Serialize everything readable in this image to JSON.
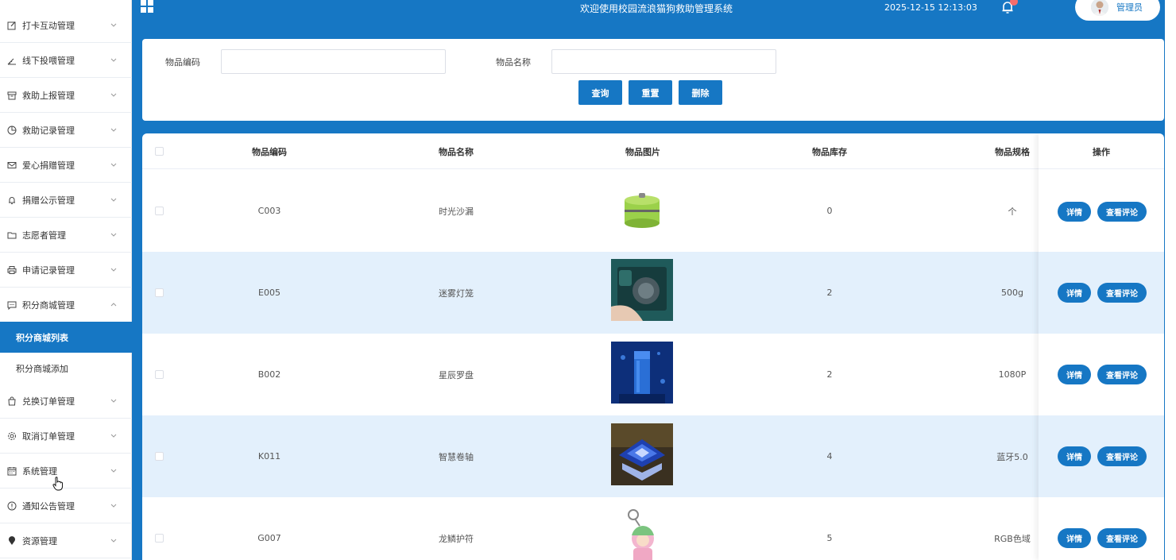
{
  "header": {
    "title": "欢迎使用校园流浪猫狗救助管理系统",
    "datetime": "2025-12-15 12:13:03",
    "notification_count": "",
    "user_name": "管理员"
  },
  "sidebar": {
    "items": [
      {
        "label": "打卡互动管理"
      },
      {
        "label": "线下投喂管理"
      },
      {
        "label": "救助上报管理"
      },
      {
        "label": "救助记录管理"
      },
      {
        "label": "爱心捐赠管理"
      },
      {
        "label": "捐赠公示管理"
      },
      {
        "label": "志愿者管理"
      },
      {
        "label": "申请记录管理"
      },
      {
        "label": "积分商城管理"
      },
      {
        "label": "兑换订单管理"
      },
      {
        "label": "取消订单管理"
      },
      {
        "label": "系统管理"
      },
      {
        "label": "通知公告管理"
      },
      {
        "label": "资源管理"
      }
    ],
    "sub_items": [
      {
        "label": "积分商城列表"
      },
      {
        "label": "积分商城添加"
      }
    ]
  },
  "search": {
    "code_label": "物品编码",
    "name_label": "物品名称",
    "code_value": "",
    "name_value": "",
    "query_label": "查询",
    "reset_label": "重置",
    "delete_label": "删除"
  },
  "table": {
    "headers": {
      "code": "物品编码",
      "name": "物品名称",
      "image": "物品图片",
      "stock": "物品库存",
      "spec": "物品规格",
      "ops": "操作"
    },
    "detail_label": "详情",
    "comments_label": "查看评论",
    "rows": [
      {
        "code": "C003",
        "name": "时光沙漏",
        "stock": "0",
        "spec": "个",
        "image": "lunchbox"
      },
      {
        "code": "E005",
        "name": "迷雾灯笼",
        "stock": "2",
        "spec": "500g",
        "image": "gadget"
      },
      {
        "code": "B002",
        "name": "星辰罗盘",
        "stock": "2",
        "spec": "1080P",
        "image": "bottle"
      },
      {
        "code": "K011",
        "name": "智慧卷轴",
        "stock": "4",
        "spec": "蓝牙5.0",
        "image": "crystal"
      },
      {
        "code": "G007",
        "name": "龙鳞护符",
        "stock": "5",
        "spec": "RGB色域",
        "image": "keychain"
      }
    ]
  },
  "colors": {
    "primary": "#1677c4",
    "row_alt": "#e3f0fc"
  }
}
